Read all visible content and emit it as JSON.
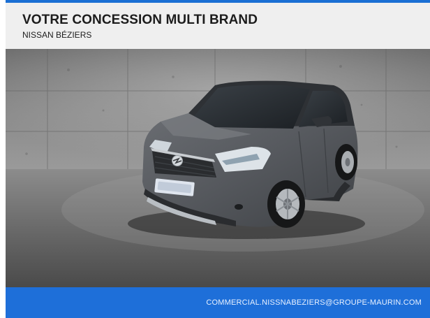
{
  "header": {
    "title": "VOTRE CONCESSION MULTI BRAND",
    "subtitle": "NISSAN BÉZIERS"
  },
  "footer": {
    "email": "COMMERCIAL.NISSNABEZIERS@GROUPE-MAURIN.COM"
  },
  "colors": {
    "accent": "#1e6fd9",
    "header_bg": "#efefef",
    "car_body": "#55585d"
  },
  "icons": {
    "brand_logo": "opel-lightning-logo"
  }
}
